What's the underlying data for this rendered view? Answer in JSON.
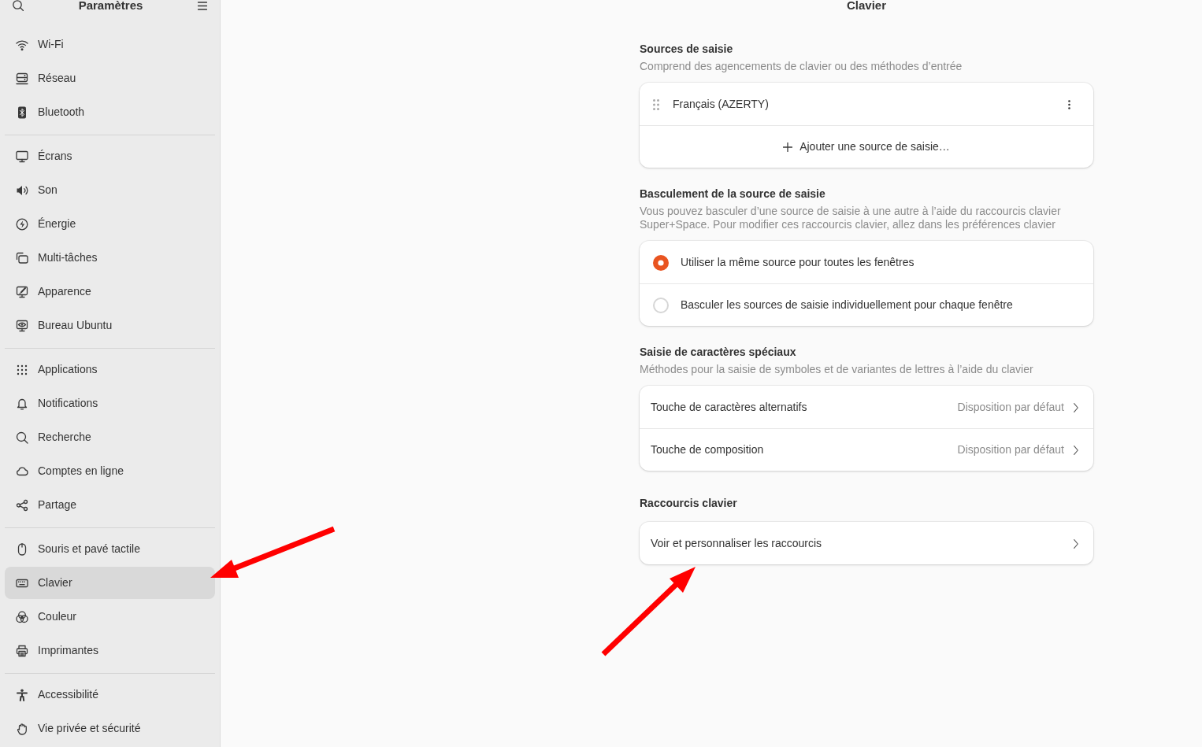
{
  "sidebar": {
    "title": "Paramètres",
    "groups": [
      {
        "items": [
          {
            "label": "Wi-Fi",
            "selected": false
          },
          {
            "label": "Réseau",
            "selected": false
          },
          {
            "label": "Bluetooth",
            "selected": false
          }
        ]
      },
      {
        "items": [
          {
            "label": "Écrans",
            "selected": false
          },
          {
            "label": "Son",
            "selected": false
          },
          {
            "label": "Énergie",
            "selected": false
          },
          {
            "label": "Multi-tâches",
            "selected": false
          },
          {
            "label": "Apparence",
            "selected": false
          },
          {
            "label": "Bureau Ubuntu",
            "selected": false
          }
        ]
      },
      {
        "items": [
          {
            "label": "Applications",
            "selected": false
          },
          {
            "label": "Notifications",
            "selected": false
          },
          {
            "label": "Recherche",
            "selected": false
          },
          {
            "label": "Comptes en ligne",
            "selected": false
          },
          {
            "label": "Partage",
            "selected": false
          }
        ]
      },
      {
        "items": [
          {
            "label": "Souris et pavé tactile",
            "selected": false
          },
          {
            "label": "Clavier",
            "selected": true
          },
          {
            "label": "Couleur",
            "selected": false
          },
          {
            "label": "Imprimantes",
            "selected": false
          }
        ]
      },
      {
        "items": [
          {
            "label": "Accessibilité",
            "selected": false
          },
          {
            "label": "Vie privée et sécurité",
            "selected": false
          }
        ]
      }
    ]
  },
  "page": {
    "title": "Clavier"
  },
  "sections": [
    {
      "heading": "Sources de saisie",
      "description": "Comprend des agencements de clavier ou des méthodes d’entrée",
      "rows": [
        {
          "kind": "source",
          "label": "Français (AZERTY)"
        },
        {
          "kind": "add",
          "label": "Ajouter une source de saisie…"
        }
      ]
    },
    {
      "heading": "Basculement de la source de saisie",
      "description": "Vous pouvez basculer d’une source de saisie à une autre à l’aide du raccourcis clavier Super+Space. Pour modifier ces raccourcis clavier, allez dans les préférences clavier",
      "rows": [
        {
          "kind": "radio",
          "label": "Utiliser la même source pour toutes les fenêtres",
          "selected": true
        },
        {
          "kind": "radio",
          "label": "Basculer les sources de saisie individuellement pour chaque fenêtre",
          "selected": false
        }
      ]
    },
    {
      "heading": "Saisie de caractères spéciaux",
      "description": "Méthodes pour la saisie de symboles et de variantes de lettres à l’aide du clavier",
      "rows": [
        {
          "kind": "link",
          "label": "Touche de caractères alternatifs",
          "value": "Disposition par défaut"
        },
        {
          "kind": "link",
          "label": "Touche de composition",
          "value": "Disposition par défaut"
        }
      ]
    },
    {
      "heading": "Raccourcis clavier",
      "rows": [
        {
          "kind": "link",
          "label": "Voir et personnaliser les raccourcis"
        }
      ]
    }
  ],
  "annotations": [
    {
      "kind": "arrow"
    },
    {
      "kind": "arrow"
    }
  ]
}
